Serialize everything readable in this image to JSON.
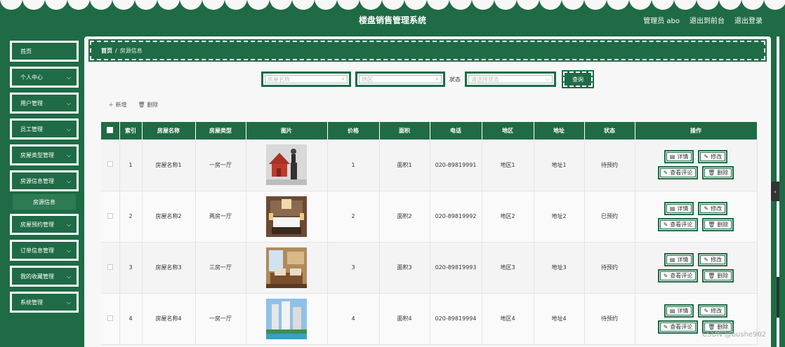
{
  "header": {
    "title": "楼盘销售管理系统",
    "user_label": "管理员 abo",
    "to_front": "退出到前台",
    "logout": "退出登录"
  },
  "sidebar": {
    "items": [
      {
        "label": "首页",
        "chevron": false
      },
      {
        "label": "个人中心",
        "chevron": true
      },
      {
        "label": "用户管理",
        "chevron": true
      },
      {
        "label": "员工管理",
        "chevron": true
      },
      {
        "label": "房屋类型管理",
        "chevron": true
      },
      {
        "label": "房源信息管理",
        "chevron": true
      }
    ],
    "sub_item": "房源信息",
    "items_after": [
      {
        "label": "房屋预约管理",
        "chevron": true
      },
      {
        "label": "订单信息管理",
        "chevron": true
      },
      {
        "label": "我的收藏管理",
        "chevron": true
      },
      {
        "label": "系统管理",
        "chevron": true
      }
    ]
  },
  "breadcrumb": {
    "home": "首页",
    "sep": "/",
    "current": "房源信息"
  },
  "search": {
    "name_placeholder": "房屋名称",
    "area_placeholder": "地区",
    "status_label": "状态",
    "status_placeholder": "请选择状态",
    "query_btn": "查询"
  },
  "actions": {
    "add": "新增",
    "delete": "删除"
  },
  "table": {
    "headers": [
      "索引",
      "房屋名称",
      "房屋类型",
      "图片",
      "价格",
      "面积",
      "电话",
      "地区",
      "地址",
      "状态",
      "操作"
    ],
    "rows": [
      {
        "index": "1",
        "name": "房屋名称1",
        "type": "一房一厅",
        "price": "1",
        "area": "面积1",
        "phone": "020-89819991",
        "region": "地区1",
        "address": "地址1",
        "status": "待预约"
      },
      {
        "index": "2",
        "name": "房屋名称2",
        "type": "两房一厅",
        "price": "2",
        "area": "面积2",
        "phone": "020-89819992",
        "region": "地区2",
        "address": "地址2",
        "status": "已预约"
      },
      {
        "index": "3",
        "name": "房屋名称3",
        "type": "三房一厅",
        "price": "3",
        "area": "面积3",
        "phone": "020-89819993",
        "region": "地区3",
        "address": "地址3",
        "status": "待预约"
      },
      {
        "index": "4",
        "name": "房屋名称4",
        "type": "一房一厅",
        "price": "4",
        "area": "面积4",
        "phone": "020-89819994",
        "region": "地区4",
        "address": "地址4",
        "status": "待预约"
      }
    ],
    "op_labels": {
      "detail": "详情",
      "edit": "修改",
      "review": "查看评论",
      "delete": "删除"
    }
  },
  "watermark": "CSDN @bushe902",
  "colors": {
    "primary": "#1f6b45",
    "bg": "#f7f7f7"
  }
}
